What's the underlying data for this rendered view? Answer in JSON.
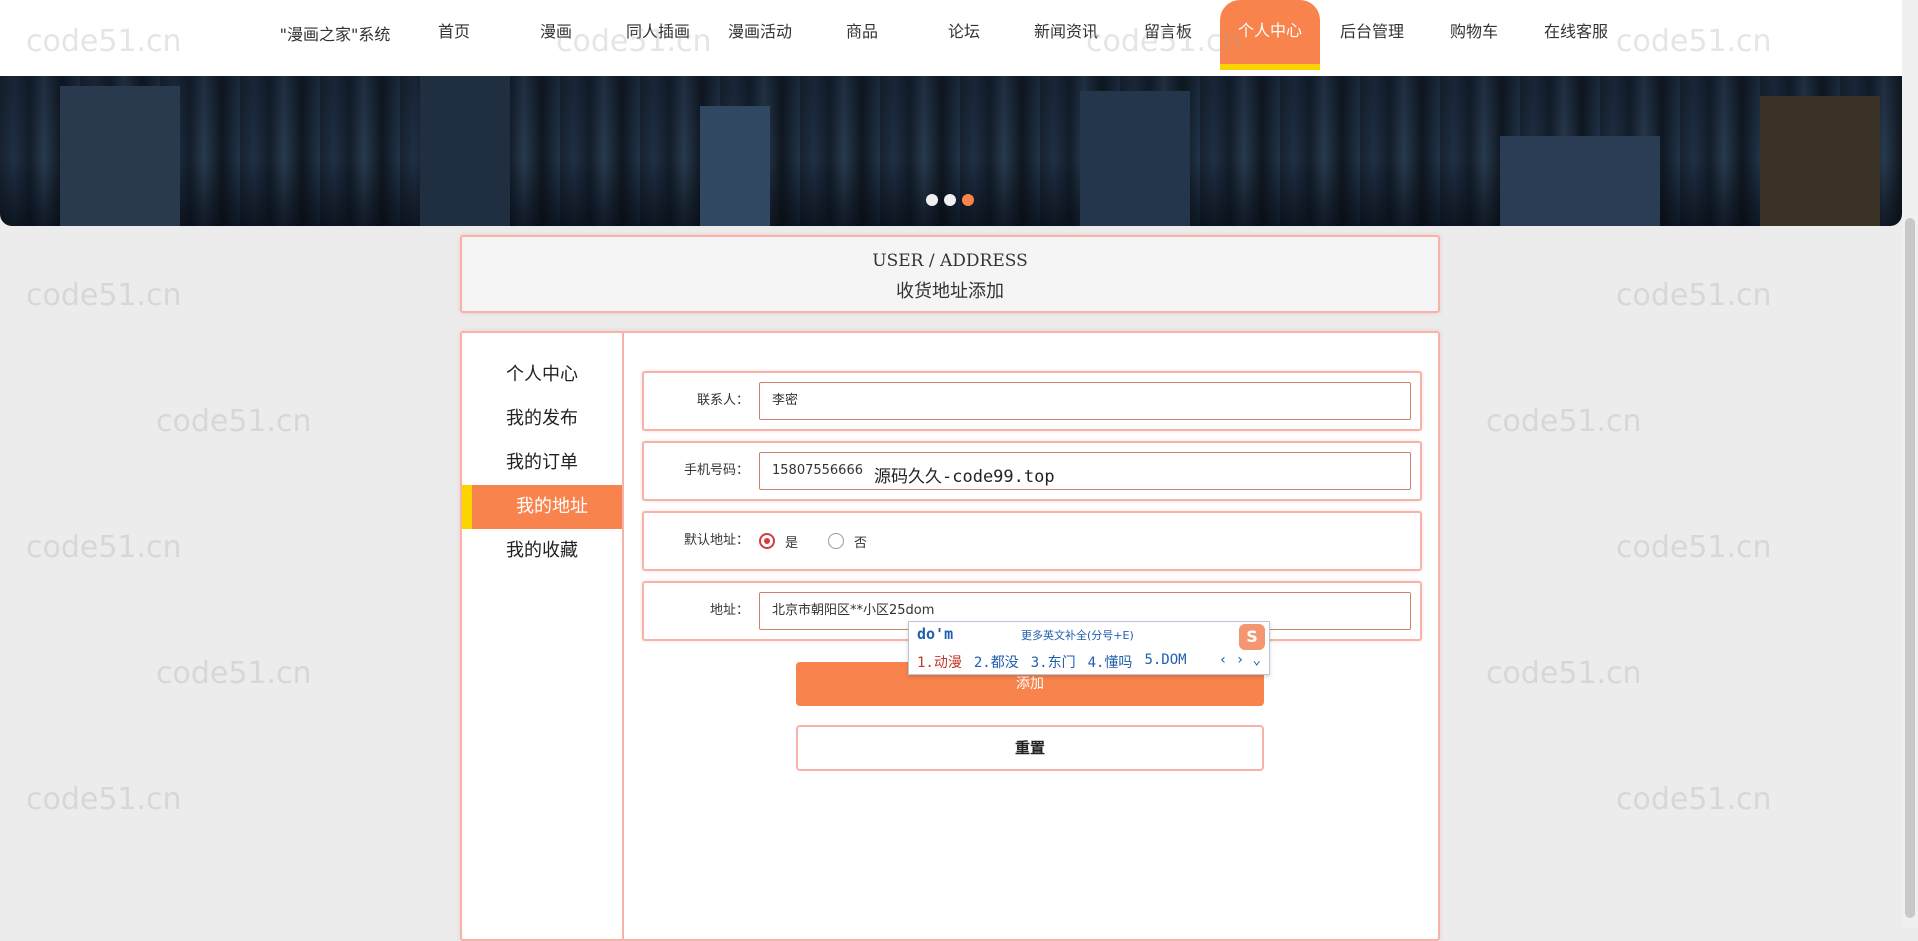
{
  "site_title": "\"漫画之家\"系统",
  "nav": [
    {
      "label": "首页"
    },
    {
      "label": "漫画"
    },
    {
      "label": "同人插画"
    },
    {
      "label": "漫画活动"
    },
    {
      "label": "商品"
    },
    {
      "label": "论坛"
    },
    {
      "label": "新闻资讯"
    },
    {
      "label": "留言板"
    },
    {
      "label": "个人中心",
      "active": true
    },
    {
      "label": "后台管理"
    },
    {
      "label": "购物车"
    },
    {
      "label": "在线客服"
    }
  ],
  "carousel": {
    "slide_count": 3,
    "active_index": 2
  },
  "header": {
    "title_en": "USER / ADDRESS",
    "title_cn": "收货地址添加"
  },
  "sidebar": [
    {
      "label": "个人中心"
    },
    {
      "label": "我的发布"
    },
    {
      "label": "我的订单"
    },
    {
      "label": "我的地址",
      "active": true
    },
    {
      "label": "我的收藏"
    }
  ],
  "form": {
    "contact_label": "联系人：",
    "contact_value": "李密",
    "phone_label": "手机号码：",
    "phone_value": "15807556666",
    "default_label": "默认地址：",
    "default_yes": "是",
    "default_no": "否",
    "default_selected": "是",
    "address_label": "地址：",
    "address_value": "北京市朝阳区**小区25dom",
    "add_button": "添加",
    "reset_button": "重置"
  },
  "ime": {
    "composition": "do'm",
    "hint": "更多英文补全(分号+E)",
    "logo": "S",
    "candidates": [
      "1.动漫",
      "2.都没",
      "3.东门",
      "4.懂吗",
      "5.DOM"
    ],
    "nav": "‹ › ⌄"
  },
  "overlay_text": "源码久久-code99.top",
  "watermark": "code51.cn",
  "colors": {
    "accent": "#f8834c",
    "accent_yellow": "#fbd400",
    "border": "#f6b3a9"
  }
}
